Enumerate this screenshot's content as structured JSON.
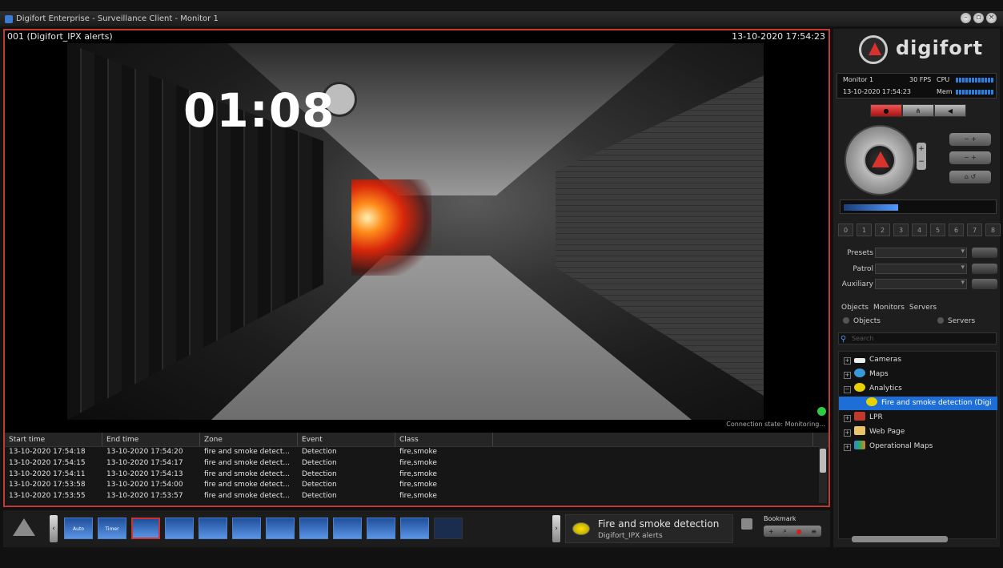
{
  "window": {
    "title": "Digifort Enterprise - Surveillance Client - Monitor 1"
  },
  "video": {
    "camera_label": "001 (Digifort_IPX alerts)",
    "timestamp": "13-10-2020 17:54:23",
    "overlay_timer": "01:08",
    "connection_state": "Connection state: Monitoring..."
  },
  "events": {
    "columns": [
      "Start time",
      "End time",
      "Zone",
      "Event",
      "Class"
    ],
    "rows": [
      [
        "13-10-2020 17:54:18",
        "13-10-2020 17:54:20",
        "fire and smoke detect...",
        "Detection",
        "fire,smoke"
      ],
      [
        "13-10-2020 17:54:15",
        "13-10-2020 17:54:17",
        "fire and smoke detect...",
        "Detection",
        "fire,smoke"
      ],
      [
        "13-10-2020 17:54:11",
        "13-10-2020 17:54:13",
        "fire and smoke detect...",
        "Detection",
        "fire,smoke"
      ],
      [
        "13-10-2020 17:53:58",
        "13-10-2020 17:54:00",
        "fire and smoke detect...",
        "Detection",
        "fire,smoke"
      ],
      [
        "13-10-2020 17:53:55",
        "13-10-2020 17:53:57",
        "fire and smoke detect...",
        "Detection",
        "fire,smoke"
      ]
    ]
  },
  "bottom": {
    "layout_labels": [
      "Auto",
      "Timer"
    ],
    "alert_title": "Fire and smoke detection",
    "alert_subtitle": "Digifort_IPX alerts",
    "bookmark_label": "Bookmark"
  },
  "panel": {
    "logo_text": "digifort",
    "monitor": "Monitor 1",
    "fps": "30 FPS",
    "cpu_label": "CPU",
    "time": "13-10-2020 17:54:23",
    "mem_label": "Mem",
    "preset_numbers": [
      "0",
      "1",
      "2",
      "3",
      "4",
      "5",
      "6",
      "7",
      "8"
    ],
    "presets_label": "Presets",
    "patrol_label": "Patrol",
    "auxiliary_label": "Auxiliary",
    "tabs": [
      "Objects",
      "Monitors",
      "Servers"
    ],
    "radio_objects": "Objects",
    "radio_servers": "Servers",
    "search_placeholder": "Search",
    "tree": [
      {
        "label": "Cameras",
        "exp": "+"
      },
      {
        "label": "Maps",
        "exp": "+"
      },
      {
        "label": "Analytics",
        "exp": "−"
      },
      {
        "label": "Fire and smoke detection (Digi",
        "exp": ""
      },
      {
        "label": "LPR",
        "exp": "+"
      },
      {
        "label": "Web Page",
        "exp": "+"
      },
      {
        "label": "Operational Maps",
        "exp": "+"
      }
    ]
  },
  "colors": {
    "accent_red": "#c23a34",
    "selection_blue": "#1e6ed8",
    "status_green": "#2ecc40"
  }
}
